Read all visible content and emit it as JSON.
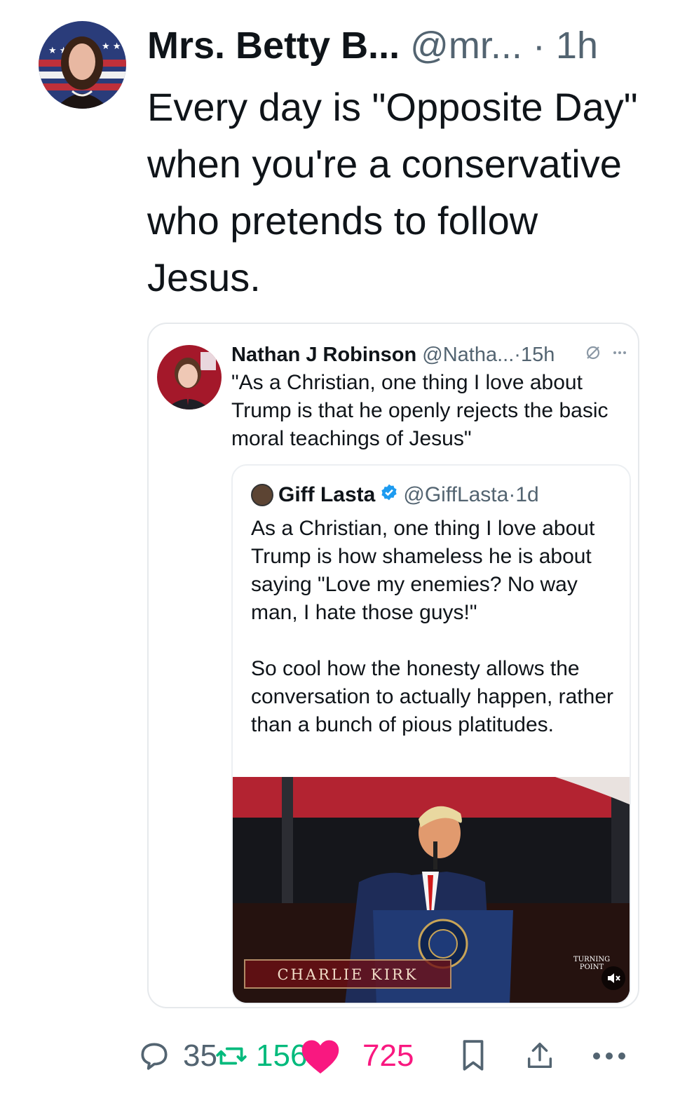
{
  "post": {
    "author_name": "Mrs. Betty B...",
    "author_handle": "@mr...",
    "separator": "·",
    "time": "1h",
    "text": "Every day is \"Opposite Day\" when you're a conservative who pretends to follow Jesus.",
    "avatar_icon": "flag-portrait-avatar"
  },
  "quoted": {
    "author_name": "Nathan J Robinson",
    "author_handle": "@Natha...",
    "time": "·15h",
    "text": "\"As a Christian, one thing I love about Trump is that he openly rejects the basic moral teachings of Jesus\"",
    "icons": [
      "grok-icon",
      "more-icon"
    ]
  },
  "nested": {
    "author_name": "Giff Lasta",
    "author_handle": "@GiffLasta",
    "time": "·1d",
    "verified": true,
    "text": "As a Christian, one thing I love about Trump is how shameless he is about saying \"Love my enemies? No way man, I hate those guys!\"\n\nSo cool how the honesty allows the conversation to actually happen, rather than a bunch of pious platitudes.",
    "media": {
      "banner_text": "CHARLIE KIRK",
      "brand_text": "TURNING POINT",
      "mute_icon": "volume-muted-icon"
    }
  },
  "actions": {
    "replies": "35",
    "reposts": "156",
    "likes": "725",
    "colors": {
      "reply": "#536471",
      "repost": "#00ba7c",
      "like": "#f91880"
    }
  },
  "colors": {
    "text": "#0f1419",
    "secondary": "#536471",
    "border": "#e6e9ec",
    "verified": "#1d9bf0"
  }
}
